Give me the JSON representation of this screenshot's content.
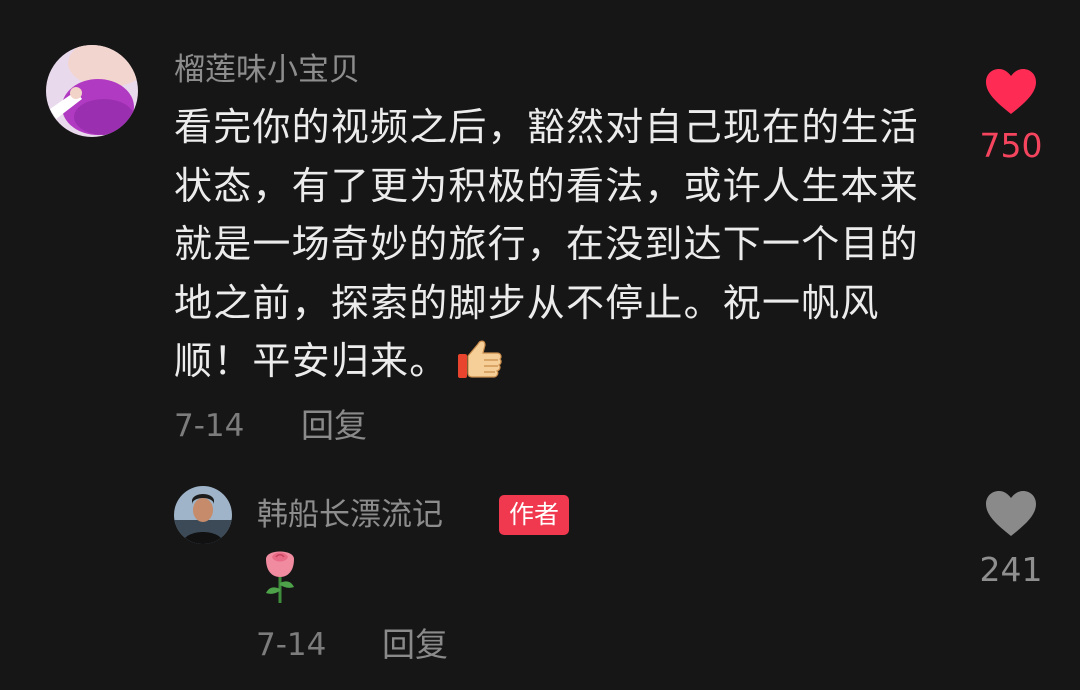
{
  "comment": {
    "username": "榴莲味小宝贝",
    "text": "看完你的视频之后，豁然对自己现在的生活状态，有了更为积极的看法，或许人生本来就是一场奇妙的旅行，在没到达下一个目的地之前，探索的脚步从不停止。祝一帆风顺！平安归来。",
    "emoji": "thumbs-up",
    "date": "7-14",
    "reply_label": "回复",
    "likes": "750",
    "liked": true,
    "like_color": "#fe2c55"
  },
  "reply": {
    "username": "韩船长漂流记",
    "badge": "作者",
    "emoji": "rose",
    "date": "7-14",
    "reply_label": "回复",
    "likes": "241",
    "liked": false,
    "like_color": "#8a8a8a"
  },
  "colors": {
    "background": "#161616",
    "text": "#ececec",
    "secondary": "#8d8d8d",
    "badge": "#f0384f"
  }
}
